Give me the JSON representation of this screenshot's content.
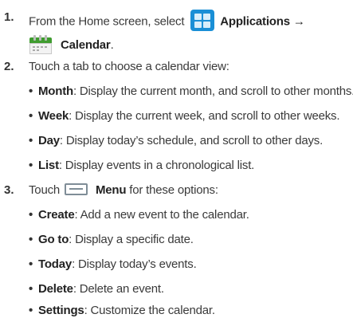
{
  "steps": [
    {
      "number": "1.",
      "prefix": "From the Home screen, select",
      "icon1": "applications-grid-icon",
      "bold1": "Applications →",
      "icon2": "calendar-icon",
      "bold2": "Calendar",
      "suffix": "."
    },
    {
      "number": "2.",
      "text": "Touch a tab to choose a calendar view:",
      "bullets": [
        {
          "term": "Month",
          "desc": ": Display the current month, and scroll to other months."
        },
        {
          "term": "Week",
          "desc": ": Display the current week, and scroll to other weeks."
        },
        {
          "term": "Day",
          "desc": ": Display today’s schedule, and scroll to other days."
        },
        {
          "term": "List",
          "desc": ": Display events in a chronological list."
        }
      ]
    },
    {
      "number": "3.",
      "prefix": "Touch",
      "icon": "menu-key-icon",
      "bold": "Menu",
      "suffix": " for these options:",
      "bullets": [
        {
          "term": "Create",
          "desc": ": Add a new event to the calendar."
        },
        {
          "term": "Go to",
          "desc": ": Display a specific date."
        },
        {
          "term": "Today",
          "desc": ": Display today’s events."
        },
        {
          "term": "Delete",
          "desc": ": Delete an event."
        },
        {
          "term": "Settings",
          "desc": ": Customize the calendar."
        }
      ]
    }
  ],
  "colors": {
    "text": "#3a3a3a",
    "applications_icon": "#1a8fd6",
    "calendar_icon": "#3f9c2f",
    "menu_icon": "#7f8d97"
  }
}
